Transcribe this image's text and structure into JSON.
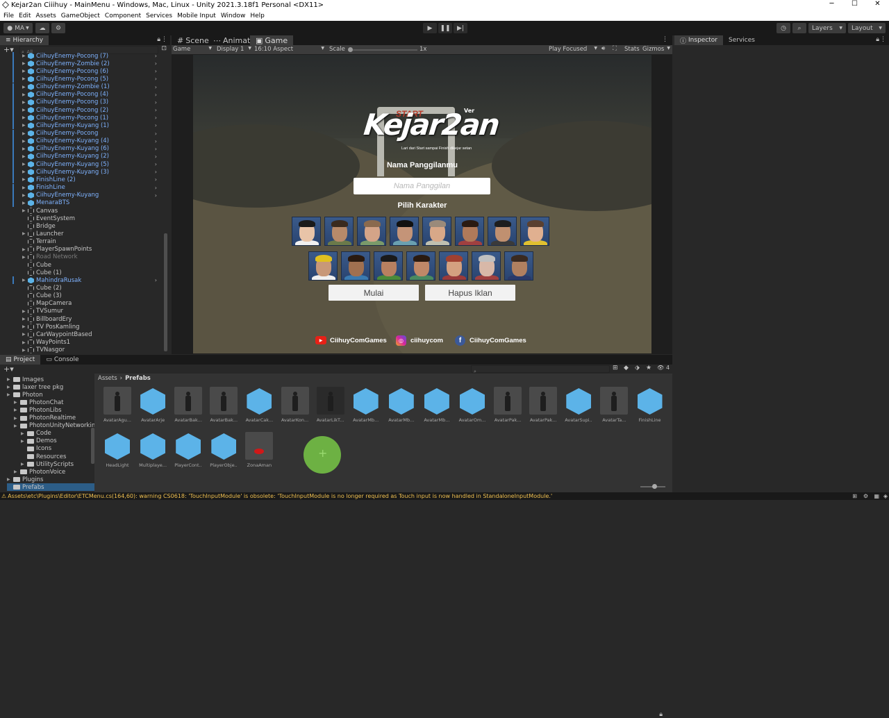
{
  "window": {
    "title": "Kejar2an Ciiihuy - MainMenu - Windows, Mac, Linux - Unity 2021.3.18f1 Personal <DX11>",
    "minimize": "─",
    "maximize": "☐",
    "close": "✕"
  },
  "menu": [
    "File",
    "Edit",
    "Assets",
    "GameObject",
    "Component",
    "Services",
    "Mobile Input",
    "Window",
    "Help"
  ],
  "toolbar": {
    "account": "MA",
    "layers": "Layers",
    "layout": "Layout"
  },
  "hierarchy": {
    "tab": "Hierarchy",
    "search_placeholder": "All",
    "rows": [
      {
        "name": "CiihuyEnemy-Pocong (7)",
        "kind": "prefab",
        "indent": 0,
        "arrow": true,
        "chev": true
      },
      {
        "name": "CiihuyEnemy-Zombie (2)",
        "kind": "prefab",
        "indent": 0,
        "arrow": true,
        "chev": true
      },
      {
        "name": "CiihuyEnemy-Pocong (6)",
        "kind": "prefab",
        "indent": 0,
        "arrow": true,
        "chev": true
      },
      {
        "name": "CiihuyEnemy-Pocong (5)",
        "kind": "prefab",
        "indent": 0,
        "arrow": true,
        "chev": true
      },
      {
        "name": "CiihuyEnemy-Zombie (1)",
        "kind": "prefab",
        "indent": 0,
        "arrow": true,
        "chev": true
      },
      {
        "name": "CiihuyEnemy-Pocong (4)",
        "kind": "prefab",
        "indent": 0,
        "arrow": true,
        "chev": true
      },
      {
        "name": "CiihuyEnemy-Pocong (3)",
        "kind": "prefab",
        "indent": 0,
        "arrow": true,
        "chev": true
      },
      {
        "name": "CiihuyEnemy-Pocong (2)",
        "kind": "prefab",
        "indent": 0,
        "arrow": true,
        "chev": true
      },
      {
        "name": "CiihuyEnemy-Pocong (1)",
        "kind": "prefab",
        "indent": 0,
        "arrow": true,
        "chev": true
      },
      {
        "name": "CiihuyEnemy-Kuyang (1)",
        "kind": "prefab",
        "indent": 0,
        "arrow": true,
        "chev": true
      },
      {
        "name": "CiihuyEnemy-Pocong",
        "kind": "prefab",
        "indent": 0,
        "arrow": true,
        "chev": true
      },
      {
        "name": "CiihuyEnemy-Kuyang (4)",
        "kind": "prefab",
        "indent": 0,
        "arrow": true,
        "chev": true
      },
      {
        "name": "CiihuyEnemy-Kuyang (6)",
        "kind": "prefab",
        "indent": 0,
        "arrow": true,
        "chev": true
      },
      {
        "name": "CiihuyEnemy-Kuyang (2)",
        "kind": "prefab",
        "indent": 0,
        "arrow": true,
        "chev": true
      },
      {
        "name": "CiihuyEnemy-Kuyang (5)",
        "kind": "prefab",
        "indent": 0,
        "arrow": true,
        "chev": true
      },
      {
        "name": "CiihuyEnemy-Kuyang (3)",
        "kind": "prefab",
        "indent": 0,
        "arrow": true,
        "chev": true
      },
      {
        "name": "FinishLine (2)",
        "kind": "prefab",
        "indent": 0,
        "arrow": true,
        "chev": true
      },
      {
        "name": "FinishLine",
        "kind": "prefab",
        "indent": 0,
        "arrow": true,
        "chev": true
      },
      {
        "name": "CiihuyEnemy-Kuyang",
        "kind": "prefab",
        "indent": 0,
        "arrow": true,
        "chev": true
      },
      {
        "name": "MenaraBTS",
        "kind": "prefab",
        "indent": 0,
        "arrow": true,
        "chev": false
      },
      {
        "name": "Canvas",
        "kind": "normal",
        "indent": 0,
        "arrow": true,
        "chev": false
      },
      {
        "name": "EventSystem",
        "kind": "normal",
        "indent": 0,
        "arrow": false,
        "chev": false
      },
      {
        "name": "Bridge",
        "kind": "normal",
        "indent": 0,
        "arrow": false,
        "chev": false
      },
      {
        "name": "Launcher",
        "kind": "normal",
        "indent": 0,
        "arrow": true,
        "chev": false
      },
      {
        "name": "Terrain",
        "kind": "normal",
        "indent": 0,
        "arrow": false,
        "chev": false
      },
      {
        "name": "PlayerSpawnPoints",
        "kind": "normal",
        "indent": 0,
        "arrow": true,
        "chev": false
      },
      {
        "name": "Road Network",
        "kind": "muted",
        "indent": 0,
        "arrow": true,
        "chev": false
      },
      {
        "name": "Cube",
        "kind": "normal",
        "indent": 0,
        "arrow": false,
        "chev": false
      },
      {
        "name": "Cube (1)",
        "kind": "normal",
        "indent": 0,
        "arrow": false,
        "chev": false
      },
      {
        "name": "MahindraRusak",
        "kind": "prefab",
        "indent": 0,
        "arrow": true,
        "chev": true
      },
      {
        "name": "Cube (2)",
        "kind": "normal",
        "indent": 0,
        "arrow": false,
        "chev": false
      },
      {
        "name": "Cube (3)",
        "kind": "normal",
        "indent": 0,
        "arrow": false,
        "chev": false
      },
      {
        "name": "MapCamera",
        "kind": "normal",
        "indent": 0,
        "arrow": false,
        "chev": false
      },
      {
        "name": "TVSumur",
        "kind": "normal",
        "indent": 0,
        "arrow": true,
        "chev": false
      },
      {
        "name": "BillboardEry",
        "kind": "normal",
        "indent": 0,
        "arrow": true,
        "chev": false
      },
      {
        "name": "TV PosKamling",
        "kind": "normal",
        "indent": 0,
        "arrow": true,
        "chev": false
      },
      {
        "name": "CarWaypointBased",
        "kind": "normal",
        "indent": 0,
        "arrow": true,
        "chev": false
      },
      {
        "name": "WayPoints1",
        "kind": "normal",
        "indent": 0,
        "arrow": true,
        "chev": false
      },
      {
        "name": "TVNasgor",
        "kind": "normal",
        "indent": 0,
        "arrow": true,
        "chev": false
      }
    ]
  },
  "center_tabs": [
    "Scene",
    "Animator",
    "Game"
  ],
  "game_toolbar": {
    "mode": "Game",
    "display": "Display 1",
    "aspect": "16:10 Aspect",
    "scale_label": "Scale",
    "scale_value": "1x",
    "play_mode": "Play Focused",
    "stats": "Stats",
    "gizmos": "Gizmos"
  },
  "game": {
    "title": "Kejar2an",
    "ver": "Ver",
    "start_sign": "START",
    "tagline": "Lari dari Start sampai Finish dikejar setan",
    "name_heading": "Nama Panggilanmu",
    "name_placeholder": "Nama Panggilan",
    "char_heading": "Pilih Karakter",
    "start_button": "Mulai",
    "remove_ads_button": "Hapus Iklan",
    "socials": [
      {
        "icon": "youtube-icon",
        "label": "CiihuyComGames",
        "color": "#e62117"
      },
      {
        "icon": "instagram-icon",
        "label": "ciihuycom",
        "color": "#c13584"
      },
      {
        "icon": "facebook-icon",
        "label": "CiihuyComGames",
        "color": "#3b5998"
      }
    ],
    "avatars_row1": [
      {
        "skin": "#e8c4a8",
        "hair": "#1a1a1a",
        "shirt": "#f0f0f0"
      },
      {
        "skin": "#b88a6a",
        "hair": "#3a2a1e",
        "shirt": "#6b7a4a"
      },
      {
        "skin": "#d4a488",
        "hair": "#8a6a4e",
        "shirt": "#7a9a6a"
      },
      {
        "skin": "#c49478",
        "hair": "#111111",
        "shirt": "#6aa0b0"
      },
      {
        "skin": "#d8a888",
        "hair": "#9a8a7a",
        "shirt": "#c0c0b0"
      },
      {
        "skin": "#b07a5a",
        "hair": "#2a1a12",
        "shirt": "#a04040"
      },
      {
        "skin": "#c09070",
        "hair": "#1e1e1e",
        "shirt": "#3a3a3a"
      },
      {
        "skin": "#e0b090",
        "hair": "#5a4030",
        "shirt": "#e0c030"
      }
    ],
    "avatars_row2": [
      {
        "skin": "#c89878",
        "hair": "#e0c020",
        "shirt": "#f0f0f0"
      },
      {
        "skin": "#a07050",
        "hair": "#2a1a10",
        "shirt": "#3a7ab0"
      },
      {
        "skin": "#b88060",
        "hair": "#1a1a1a",
        "shirt": "#4a8a3a"
      },
      {
        "skin": "#c08868",
        "hair": "#2a1a10",
        "shirt": "#4a8a60"
      },
      {
        "skin": "#d4a080",
        "hair": "#a04030",
        "shirt": "#9a3a3a"
      },
      {
        "skin": "#d8b8a8",
        "hair": "#c0c0c0",
        "shirt": "#a04040"
      },
      {
        "skin": "#b08060",
        "hair": "#3a2a20",
        "shirt": "#2a3a6a"
      }
    ]
  },
  "inspector": {
    "tabs": [
      "Inspector",
      "Services"
    ]
  },
  "project": {
    "tabs": [
      "Project",
      "Console"
    ],
    "breadcrumb": [
      "Assets",
      "Prefabs"
    ],
    "hidden_count": "4",
    "folders": [
      {
        "name": "Images",
        "depth": 1,
        "arrow": true
      },
      {
        "name": "laxer tree pkg",
        "depth": 1,
        "arrow": true
      },
      {
        "name": "Photon",
        "depth": 1,
        "arrow": true
      },
      {
        "name": "PhotonChat",
        "depth": 2,
        "arrow": true
      },
      {
        "name": "PhotonLibs",
        "depth": 2,
        "arrow": true
      },
      {
        "name": "PhotonRealtime",
        "depth": 2,
        "arrow": true
      },
      {
        "name": "PhotonUnityNetworking",
        "depth": 2,
        "arrow": true
      },
      {
        "name": "Code",
        "depth": 3,
        "arrow": true
      },
      {
        "name": "Demos",
        "depth": 3,
        "arrow": true
      },
      {
        "name": "Icons",
        "depth": 3,
        "arrow": false
      },
      {
        "name": "Resources",
        "depth": 3,
        "arrow": false
      },
      {
        "name": "UtilityScripts",
        "depth": 3,
        "arrow": true
      },
      {
        "name": "PhotonVoice",
        "depth": 2,
        "arrow": true
      },
      {
        "name": "Plugins",
        "depth": 1,
        "arrow": true
      },
      {
        "name": "Prefabs",
        "depth": 1,
        "arrow": false
      }
    ],
    "assets": [
      {
        "name": "AvatarAgu...",
        "type": "figure"
      },
      {
        "name": "AvatarArje",
        "type": "cube"
      },
      {
        "name": "AvatarBak...",
        "type": "figure"
      },
      {
        "name": "AvatarBak...",
        "type": "figure"
      },
      {
        "name": "AvatarCak...",
        "type": "cube"
      },
      {
        "name": "AvatarKon...",
        "type": "figure"
      },
      {
        "name": "AvatarLikT...",
        "type": "figure-dark"
      },
      {
        "name": "AvatarMb...",
        "type": "cube"
      },
      {
        "name": "AvatarMb...",
        "type": "cube"
      },
      {
        "name": "AvatarMb...",
        "type": "cube"
      },
      {
        "name": "AvatarOm...",
        "type": "cube"
      },
      {
        "name": "AvatarPak...",
        "type": "figure"
      },
      {
        "name": "AvatarPak...",
        "type": "figure"
      },
      {
        "name": "AvatarSupi...",
        "type": "cube"
      },
      {
        "name": "AvatarTa...",
        "type": "figure"
      },
      {
        "name": "FinishLine",
        "type": "cube"
      },
      {
        "name": "HeadLight",
        "type": "cube"
      },
      {
        "name": "Multiplaye...",
        "type": "cube"
      },
      {
        "name": "PlayerCont...",
        "type": "cube"
      },
      {
        "name": "PlayerObje...",
        "type": "cube"
      },
      {
        "name": "ZonaAman",
        "type": "zone"
      }
    ]
  },
  "statusbar": {
    "message": "Assets\\etc\\Plugins\\Editor\\ETCMenu.cs(164,60): warning CS0618: 'TouchInputModule' is obsolete: 'TouchInputModule is no longer required as Touch input is now handled in StandaloneInputModule.'"
  },
  "colors": {
    "accent": "#3a79bb",
    "prefab_text": "#7fb3ff",
    "warning": "#f0c050"
  }
}
